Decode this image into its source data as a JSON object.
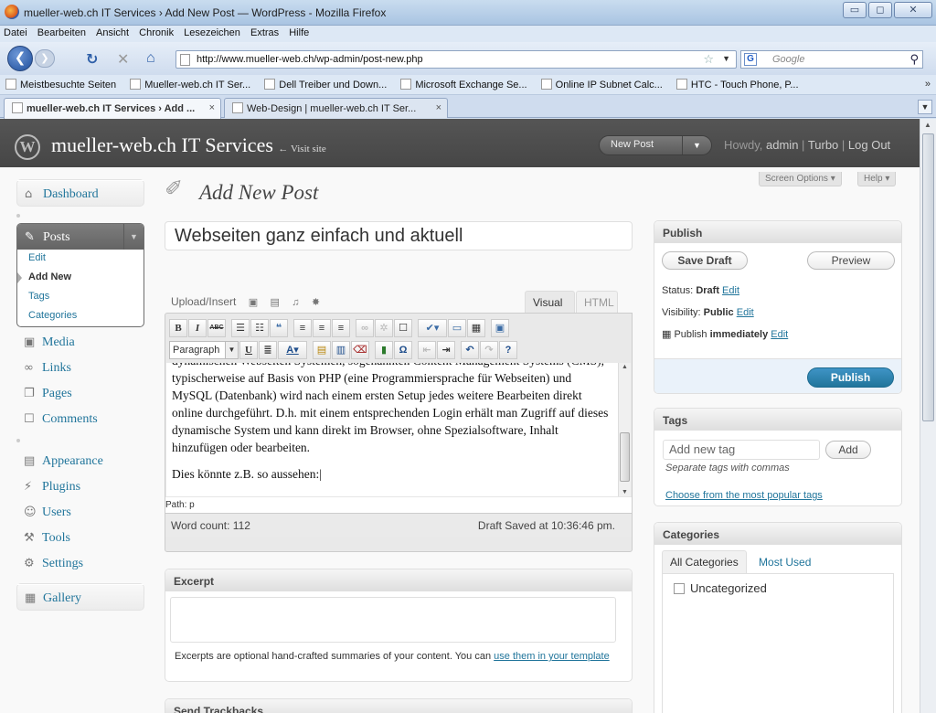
{
  "browser": {
    "window_title": "mueller-web.ch IT Services › Add New Post — WordPress - Mozilla Firefox",
    "menu": [
      "Datei",
      "Bearbeiten",
      "Ansicht",
      "Chronik",
      "Lesezeichen",
      "Extras",
      "Hilfe"
    ],
    "url": "http://www.mueller-web.ch/wp-admin/post-new.php",
    "search_placeholder": "Google",
    "bookmarks": [
      "Meistbesuchte Seiten",
      "Mueller-web.ch IT Ser...",
      "Dell Treiber und Down...",
      "Microsoft Exchange Se...",
      "Online IP Subnet Calc...",
      "HTC - Touch Phone, P..."
    ],
    "bookmarks_more": "»",
    "tabs": [
      {
        "label": "mueller-web.ch IT Services › Add ...",
        "active": true
      },
      {
        "label": "Web-Design | mueller-web.ch IT Ser...",
        "active": false
      }
    ],
    "close_glyph": "×"
  },
  "header": {
    "site_title": "mueller-web.ch IT Services",
    "visit_site": "← Visit site",
    "favorite_action": "New Post",
    "howdy_prefix": "Howdy,",
    "user": "admin",
    "links": [
      "Turbo",
      "Log Out"
    ],
    "screen_options": "Screen Options",
    "help": "Help"
  },
  "menu": {
    "dashboard": "Dashboard",
    "posts": "Posts",
    "posts_sub": [
      "Edit",
      "Add New",
      "Tags",
      "Categories"
    ],
    "group2": [
      "Media",
      "Links",
      "Pages",
      "Comments"
    ],
    "group3": [
      "Appearance",
      "Plugins",
      "Users",
      "Tools",
      "Settings"
    ],
    "gallery": "Gallery"
  },
  "page": {
    "title": "Add New Post",
    "post_title": "Webseiten ganz einfach und aktuell"
  },
  "editor": {
    "upload_insert": "Upload/Insert",
    "tab_visual": "Visual",
    "tab_html": "HTML",
    "format_select": "Paragraph",
    "paragraph_1": "dynamischen Webseiten Systemen, sogenannten Content Management Systems (CMS), typischerweise auf Basis von PHP (eine Programmiersprache für Webseiten) und MySQL (Datenbank) wird nach einem ersten Setup jedes weitere Bearbeiten direkt online durchgeführt. D.h. mit einem entsprechenden Login erhält man Zugriff auf dieses dynamische System und kann direkt im Browser, ohne Spezialsoftware, Inhalt hinzufügen oder bearbeiten.",
    "paragraph_2": "Dies könnte z.B. so aussehen:",
    "path": "Path: p",
    "word_count": "Word count: 112",
    "draft_saved": "Draft Saved at 10:36:46 pm."
  },
  "excerpt": {
    "title": "Excerpt",
    "note": "Excerpts are optional hand-crafted summaries of your content. You can ",
    "note_link": "use them in your template"
  },
  "trackbacks": {
    "title": "Send Trackbacks"
  },
  "publish": {
    "title": "Publish",
    "save_draft": "Save Draft",
    "preview": "Preview",
    "status_label": "Status:",
    "status_value": "Draft",
    "visibility_label": "Visibility:",
    "visibility_value": "Public",
    "publish_label": "Publish",
    "publish_value": "immediately",
    "edit": "Edit",
    "publish_button": "Publish"
  },
  "tags": {
    "title": "Tags",
    "placeholder": "Add new tag",
    "add": "Add",
    "hint": "Separate tags with commas",
    "choose": "Choose from the most popular tags"
  },
  "categories": {
    "title": "Categories",
    "tab_all": "All Categories",
    "tab_used": "Most Used",
    "items": [
      "Uncategorized"
    ]
  }
}
